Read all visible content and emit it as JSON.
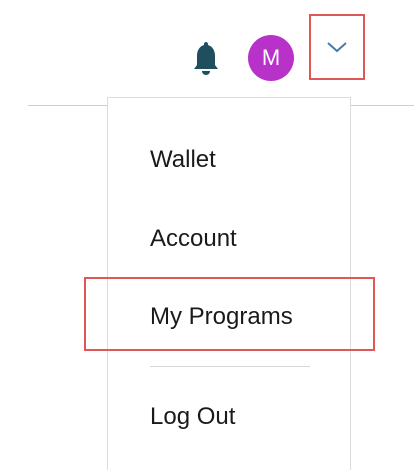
{
  "header": {
    "notifications_icon": "bell-icon",
    "avatar_initial": "M",
    "avatar_color": "#b832c9",
    "dropdown_icon": "chevron-down-icon"
  },
  "menu": {
    "items": [
      {
        "label": "Wallet"
      },
      {
        "label": "Account"
      },
      {
        "label": "My Programs"
      },
      {
        "label": "Log Out"
      }
    ]
  },
  "colors": {
    "highlight": "#e05757",
    "icon_teal": "#1f4e5e",
    "chevron": "#4a7aa8"
  }
}
